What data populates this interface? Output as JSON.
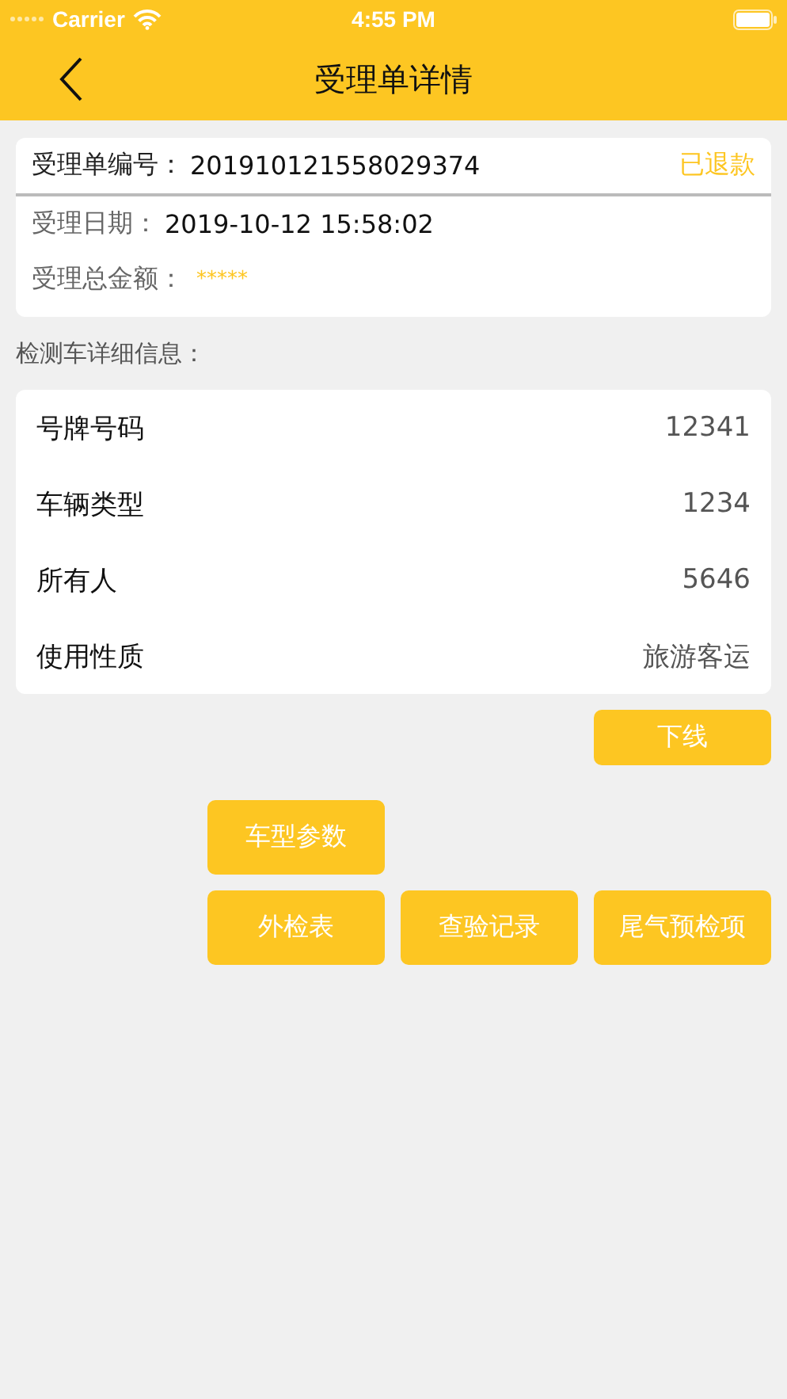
{
  "status_bar": {
    "carrier": "Carrier",
    "time": "4:55 PM"
  },
  "nav": {
    "title": "受理单详情"
  },
  "summary": {
    "number_label": "受理单编号：",
    "number": "201910121558029374",
    "status": "已退款",
    "date_label": "受理日期：",
    "date": "2019-10-12 15:58:02",
    "amount_label": "受理总金额：",
    "amount": "*****"
  },
  "section_title": "检测车详细信息：",
  "details": [
    {
      "label": "号牌号码",
      "value": "12341"
    },
    {
      "label": "车辆类型",
      "value": "1234"
    },
    {
      "label": "所有人",
      "value": "5646"
    },
    {
      "label": "使用性质",
      "value": "旅游客运"
    }
  ],
  "buttons": [
    "下线",
    "车型参数",
    "外检表",
    "查验记录",
    "尾气预检项"
  ]
}
